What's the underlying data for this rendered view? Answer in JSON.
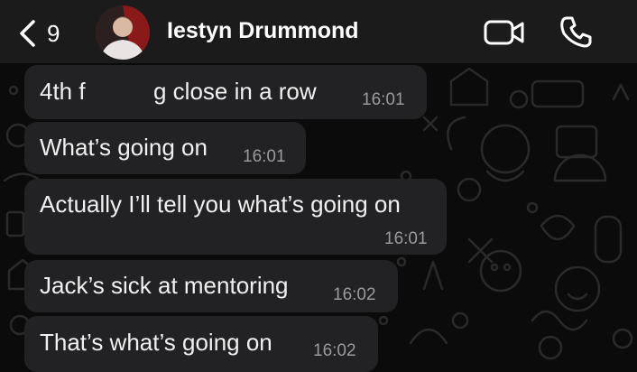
{
  "header": {
    "back_count": "9",
    "contact_name": "Iestyn Drummond"
  },
  "messages": [
    {
      "text_start": "4th f",
      "text_end": "g close in a row",
      "time": "16:01"
    },
    {
      "text": "What’s going on",
      "time": "16:01"
    },
    {
      "text": "Actually I’ll tell you what’s going on",
      "time": "16:01"
    },
    {
      "text": "Jack’s sick at mentoring",
      "time": "16:02"
    },
    {
      "text": "That’s what’s going on",
      "time": "16:02"
    }
  ],
  "icons": {
    "back": "chevron-left-icon",
    "video": "video-camera-icon",
    "call": "phone-icon"
  },
  "colors": {
    "background": "#0b0b0b",
    "header": "#1b1b1b",
    "bubble": "#222224",
    "timestamp": "#9a9a9a"
  }
}
